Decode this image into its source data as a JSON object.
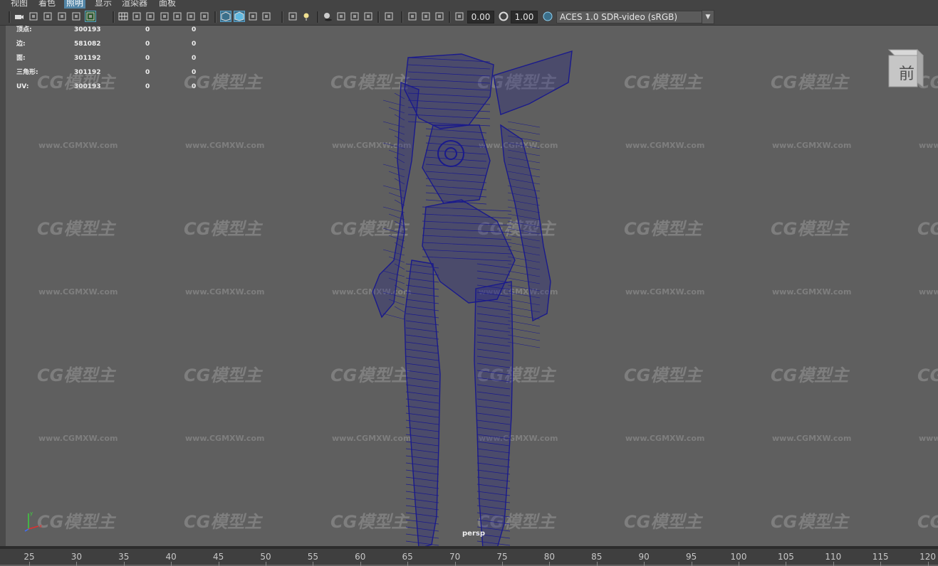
{
  "menu": {
    "items": [
      "视图",
      "着色",
      "照明",
      "显示",
      "渲染器",
      "面板"
    ],
    "active_index": 2
  },
  "toolbar": {
    "exposure_value": "0.00",
    "gamma_value": "1.00",
    "colorspace_label": "ACES 1.0 SDR-video (sRGB)",
    "icons": [
      "select-camera-icon",
      "camera-attributes-icon",
      "bookmarks-icon",
      "image-plane-icon",
      "2d-pan-zoom-icon",
      "grease-pencil-icon",
      "grid-icon",
      "film-gate-icon",
      "resolution-gate-icon",
      "gate-mask-icon",
      "field-chart-icon",
      "safe-action-icon",
      "safe-title-icon",
      "wireframe-icon",
      "smooth-shade-icon",
      "flat-shade-icon",
      "bounding-box-icon",
      "textured-icon",
      "use-all-lights-icon",
      "shadows-icon",
      "ambient-occlusion-icon",
      "motion-blur-icon",
      "anti-aliasing-icon",
      "xray-icon",
      "isolate-select-icon",
      "xray-joints-icon",
      "backface-culling-icon",
      "frame-selected-icon",
      "exposure-icon",
      "gamma-icon",
      "color-management-icon"
    ]
  },
  "hud": {
    "rows": [
      {
        "label": "顶点:",
        "v1": "300193",
        "v2": "0",
        "v3": "0"
      },
      {
        "label": "边:",
        "v1": "581082",
        "v2": "0",
        "v3": "0"
      },
      {
        "label": "面:",
        "v1": "301192",
        "v2": "0",
        "v3": "0"
      },
      {
        "label": "三角形:",
        "v1": "301192",
        "v2": "0",
        "v3": "0"
      },
      {
        "label": "UV:",
        "v1": "300193",
        "v2": "0",
        "v3": "0"
      }
    ]
  },
  "viewport": {
    "camera_label": "persp",
    "viewcube_label": "前",
    "watermark_logo": "CG模型主",
    "watermark_url": "www.CGMXW.com",
    "wireframe_color": "#1a1a8c",
    "background_color": "#5f5f5f"
  },
  "timeline": {
    "ticks": [
      "25",
      "30",
      "35",
      "40",
      "45",
      "50",
      "55",
      "60",
      "65",
      "70",
      "75",
      "80",
      "85",
      "90",
      "95",
      "100",
      "105",
      "110",
      "115",
      "120"
    ]
  }
}
